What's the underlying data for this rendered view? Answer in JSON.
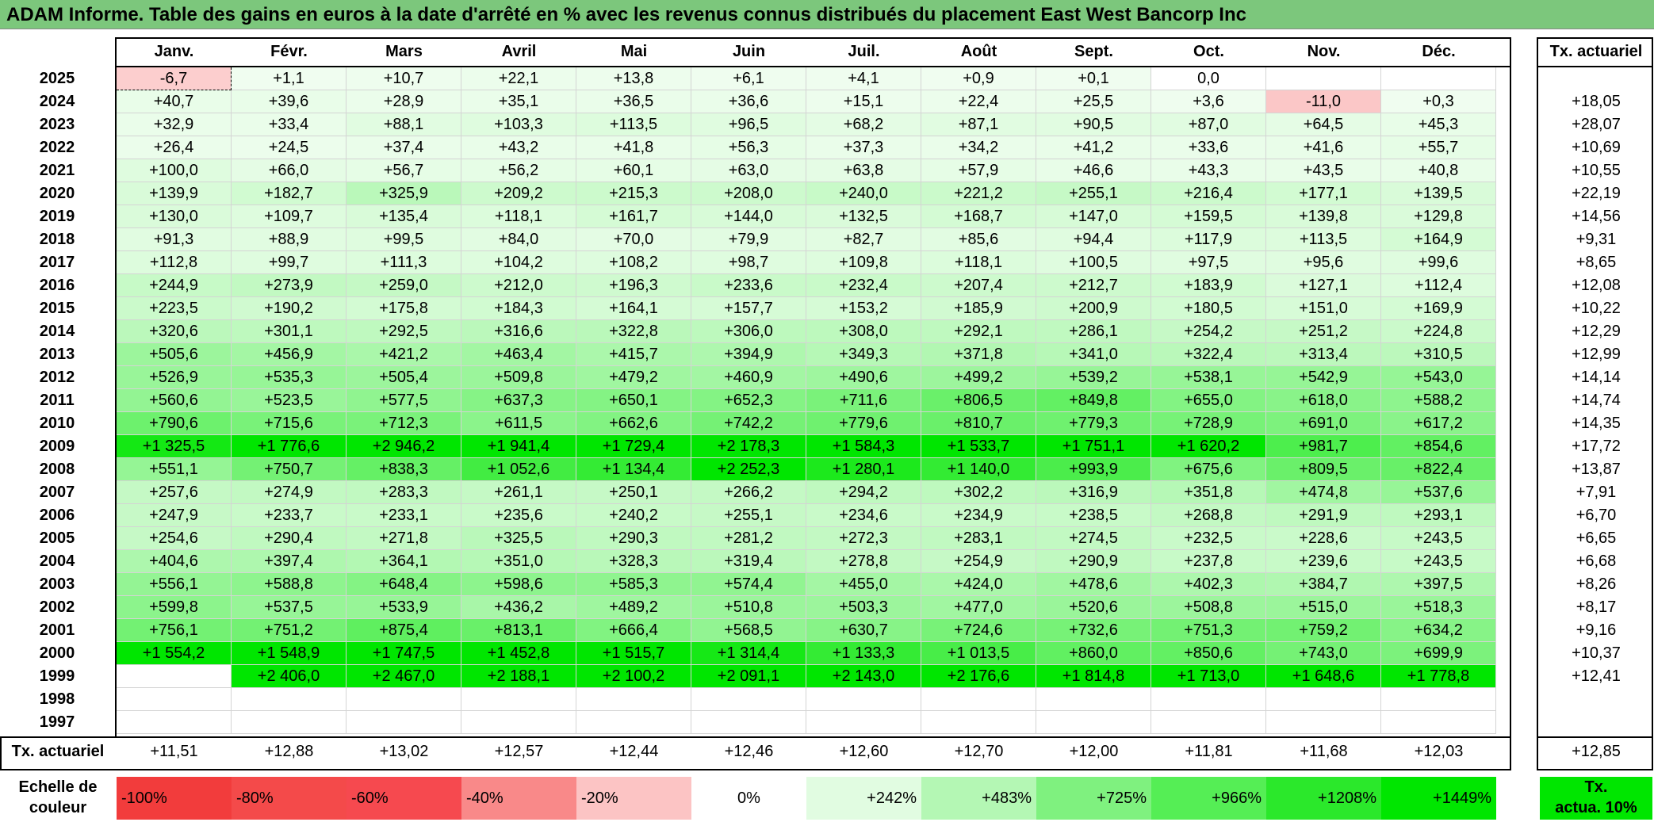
{
  "title": "ADAM Informe. Table des gains en euros à la date d'arrêté en % avec les revenus connus distribués du placement East West Bancorp Inc",
  "months": [
    "Janv.",
    "Févr.",
    "Mars",
    "Avril",
    "Mai",
    "Juin",
    "Juil.",
    "Août",
    "Sept.",
    "Oct.",
    "Nov.",
    "Déc."
  ],
  "annual_header": "Tx. actuariel",
  "rows": [
    {
      "year": "2025",
      "values": [
        "-6,7",
        "+1,1",
        "+10,7",
        "+22,1",
        "+13,8",
        "+6,1",
        "+4,1",
        "+0,9",
        "+0,1",
        "0,0",
        "",
        ""
      ],
      "rate": ""
    },
    {
      "year": "2024",
      "values": [
        "+40,7",
        "+39,6",
        "+28,9",
        "+35,1",
        "+36,5",
        "+36,6",
        "+15,1",
        "+22,4",
        "+25,5",
        "+3,6",
        "-11,0",
        "+0,3"
      ],
      "rate": "+18,05"
    },
    {
      "year": "2023",
      "values": [
        "+32,9",
        "+33,4",
        "+88,1",
        "+103,3",
        "+113,5",
        "+96,5",
        "+68,2",
        "+87,1",
        "+90,5",
        "+87,0",
        "+64,5",
        "+45,3"
      ],
      "rate": "+28,07"
    },
    {
      "year": "2022",
      "values": [
        "+26,4",
        "+24,5",
        "+37,4",
        "+43,2",
        "+41,8",
        "+56,3",
        "+37,3",
        "+34,2",
        "+41,2",
        "+33,6",
        "+41,6",
        "+55,7"
      ],
      "rate": "+10,69"
    },
    {
      "year": "2021",
      "values": [
        "+100,0",
        "+66,0",
        "+56,7",
        "+56,2",
        "+60,1",
        "+63,0",
        "+63,8",
        "+57,9",
        "+46,6",
        "+43,3",
        "+43,5",
        "+40,8"
      ],
      "rate": "+10,55"
    },
    {
      "year": "2020",
      "values": [
        "+139,9",
        "+182,7",
        "+325,9",
        "+209,2",
        "+215,3",
        "+208,0",
        "+240,0",
        "+221,2",
        "+255,1",
        "+216,4",
        "+177,1",
        "+139,5"
      ],
      "rate": "+22,19"
    },
    {
      "year": "2019",
      "values": [
        "+130,0",
        "+109,7",
        "+135,4",
        "+118,1",
        "+161,7",
        "+144,0",
        "+132,5",
        "+168,7",
        "+147,0",
        "+159,5",
        "+139,8",
        "+129,8"
      ],
      "rate": "+14,56"
    },
    {
      "year": "2018",
      "values": [
        "+91,3",
        "+88,9",
        "+99,5",
        "+84,0",
        "+70,0",
        "+79,9",
        "+82,7",
        "+85,6",
        "+94,4",
        "+117,9",
        "+113,5",
        "+164,9"
      ],
      "rate": "+9,31"
    },
    {
      "year": "2017",
      "values": [
        "+112,8",
        "+99,7",
        "+111,3",
        "+104,2",
        "+108,2",
        "+98,7",
        "+109,8",
        "+118,1",
        "+100,5",
        "+97,5",
        "+95,6",
        "+99,6"
      ],
      "rate": "+8,65"
    },
    {
      "year": "2016",
      "values": [
        "+244,9",
        "+273,9",
        "+259,0",
        "+212,0",
        "+196,3",
        "+233,6",
        "+232,4",
        "+207,4",
        "+212,7",
        "+183,9",
        "+127,1",
        "+112,4"
      ],
      "rate": "+12,08"
    },
    {
      "year": "2015",
      "values": [
        "+223,5",
        "+190,2",
        "+175,8",
        "+184,3",
        "+164,1",
        "+157,7",
        "+153,2",
        "+185,9",
        "+200,9",
        "+180,5",
        "+151,0",
        "+169,9"
      ],
      "rate": "+10,22"
    },
    {
      "year": "2014",
      "values": [
        "+320,6",
        "+301,1",
        "+292,5",
        "+316,6",
        "+322,8",
        "+306,0",
        "+308,0",
        "+292,1",
        "+286,1",
        "+254,2",
        "+251,2",
        "+224,8"
      ],
      "rate": "+12,29"
    },
    {
      "year": "2013",
      "values": [
        "+505,6",
        "+456,9",
        "+421,2",
        "+463,4",
        "+415,7",
        "+394,9",
        "+349,3",
        "+371,8",
        "+341,0",
        "+322,4",
        "+313,4",
        "+310,5"
      ],
      "rate": "+12,99"
    },
    {
      "year": "2012",
      "values": [
        "+526,9",
        "+535,3",
        "+505,4",
        "+509,8",
        "+479,2",
        "+460,9",
        "+490,6",
        "+499,2",
        "+539,2",
        "+538,1",
        "+542,9",
        "+543,0"
      ],
      "rate": "+14,14"
    },
    {
      "year": "2011",
      "values": [
        "+560,6",
        "+523,5",
        "+577,5",
        "+637,3",
        "+650,1",
        "+652,3",
        "+711,6",
        "+806,5",
        "+849,8",
        "+655,0",
        "+618,0",
        "+588,2"
      ],
      "rate": "+14,74"
    },
    {
      "year": "2010",
      "values": [
        "+790,6",
        "+715,6",
        "+712,3",
        "+611,5",
        "+662,6",
        "+742,2",
        "+779,6",
        "+810,7",
        "+779,3",
        "+728,9",
        "+691,0",
        "+617,2"
      ],
      "rate": "+14,35"
    },
    {
      "year": "2009",
      "values": [
        "+1 325,5",
        "+1 776,6",
        "+2 946,2",
        "+1 941,4",
        "+1 729,4",
        "+2 178,3",
        "+1 584,3",
        "+1 533,7",
        "+1 751,1",
        "+1 620,2",
        "+981,7",
        "+854,6"
      ],
      "rate": "+17,72"
    },
    {
      "year": "2008",
      "values": [
        "+551,1",
        "+750,7",
        "+838,3",
        "+1 052,6",
        "+1 134,4",
        "+2 252,3",
        "+1 280,1",
        "+1 140,0",
        "+993,9",
        "+675,6",
        "+809,5",
        "+822,4"
      ],
      "rate": "+13,87"
    },
    {
      "year": "2007",
      "values": [
        "+257,6",
        "+274,9",
        "+283,3",
        "+261,1",
        "+250,1",
        "+266,2",
        "+294,2",
        "+302,2",
        "+316,9",
        "+351,8",
        "+474,8",
        "+537,6"
      ],
      "rate": "+7,91"
    },
    {
      "year": "2006",
      "values": [
        "+247,9",
        "+233,7",
        "+233,1",
        "+235,6",
        "+240,2",
        "+255,1",
        "+234,6",
        "+234,9",
        "+238,5",
        "+268,8",
        "+291,9",
        "+293,1"
      ],
      "rate": "+6,70"
    },
    {
      "year": "2005",
      "values": [
        "+254,6",
        "+290,4",
        "+271,8",
        "+325,5",
        "+290,3",
        "+281,2",
        "+272,3",
        "+283,1",
        "+274,5",
        "+232,5",
        "+228,6",
        "+243,5"
      ],
      "rate": "+6,65"
    },
    {
      "year": "2004",
      "values": [
        "+404,6",
        "+397,4",
        "+364,1",
        "+351,0",
        "+328,3",
        "+319,4",
        "+278,8",
        "+254,9",
        "+290,9",
        "+237,8",
        "+239,6",
        "+243,5"
      ],
      "rate": "+6,68"
    },
    {
      "year": "2003",
      "values": [
        "+556,1",
        "+588,8",
        "+648,4",
        "+598,6",
        "+585,3",
        "+574,4",
        "+455,0",
        "+424,0",
        "+478,6",
        "+402,3",
        "+384,7",
        "+397,5"
      ],
      "rate": "+8,26"
    },
    {
      "year": "2002",
      "values": [
        "+599,8",
        "+537,5",
        "+533,9",
        "+436,2",
        "+489,2",
        "+510,8",
        "+503,3",
        "+477,0",
        "+520,6",
        "+508,8",
        "+515,0",
        "+518,3"
      ],
      "rate": "+8,17"
    },
    {
      "year": "2001",
      "values": [
        "+756,1",
        "+751,2",
        "+875,4",
        "+813,1",
        "+666,4",
        "+568,5",
        "+630,7",
        "+724,6",
        "+732,6",
        "+751,3",
        "+759,2",
        "+634,2"
      ],
      "rate": "+9,16"
    },
    {
      "year": "2000",
      "values": [
        "+1 554,2",
        "+1 548,9",
        "+1 747,5",
        "+1 452,8",
        "+1 515,7",
        "+1 314,4",
        "+1 133,3",
        "+1 013,5",
        "+860,0",
        "+850,6",
        "+743,0",
        "+699,9"
      ],
      "rate": "+10,37"
    },
    {
      "year": "1999",
      "values": [
        "",
        "+2 406,0",
        "+2 467,0",
        "+2 188,1",
        "+2 100,2",
        "+2 091,1",
        "+2 143,0",
        "+2 176,6",
        "+1 814,8",
        "+1 713,0",
        "+1 648,6",
        "+1 778,8"
      ],
      "rate": "+12,41"
    },
    {
      "year": "1998",
      "values": [
        "",
        "",
        "",
        "",
        "",
        "",
        "",
        "",
        "",
        "",
        "",
        ""
      ],
      "rate": ""
    },
    {
      "year": "1997",
      "values": [
        "",
        "",
        "",
        "",
        "",
        "",
        "",
        "",
        "",
        "",
        "",
        ""
      ],
      "rate": ""
    }
  ],
  "footer": {
    "label": "Tx. actuariel",
    "values": [
      "+11,51",
      "+12,88",
      "+13,02",
      "+12,57",
      "+12,44",
      "+12,46",
      "+12,60",
      "+12,70",
      "+12,00",
      "+11,81",
      "+11,68",
      "+12,03"
    ],
    "overall": "+12,85"
  },
  "scale": {
    "label_line1": "Echelle de",
    "label_line2": "couleur",
    "stops": [
      {
        "text": "-100%",
        "color": "#f23c3c"
      },
      {
        "text": "-80%",
        "color": "#f44a4a"
      },
      {
        "text": "-60%",
        "color": "#f6494f"
      },
      {
        "text": "-40%",
        "color": "#f98989"
      },
      {
        "text": "-20%",
        "color": "#fcc4c4"
      },
      {
        "text": "0%",
        "color": "#ffffff"
      },
      {
        "text": "+242%",
        "color": "#e1fce1"
      },
      {
        "text": "+483%",
        "color": "#b4f7b4"
      },
      {
        "text": "+725%",
        "color": "#7ff17f"
      },
      {
        "text": "+966%",
        "color": "#55ee55"
      },
      {
        "text": "+1208%",
        "color": "#2be82b"
      },
      {
        "text": "+1449%",
        "color": "#00e600"
      }
    ],
    "legend_line1": "Tx.",
    "legend_line2": "actua. 10%"
  },
  "colors": {
    "title_bg": "#7cc77c",
    "max_green": "#00e600",
    "negative_red": "#f23c3c"
  }
}
